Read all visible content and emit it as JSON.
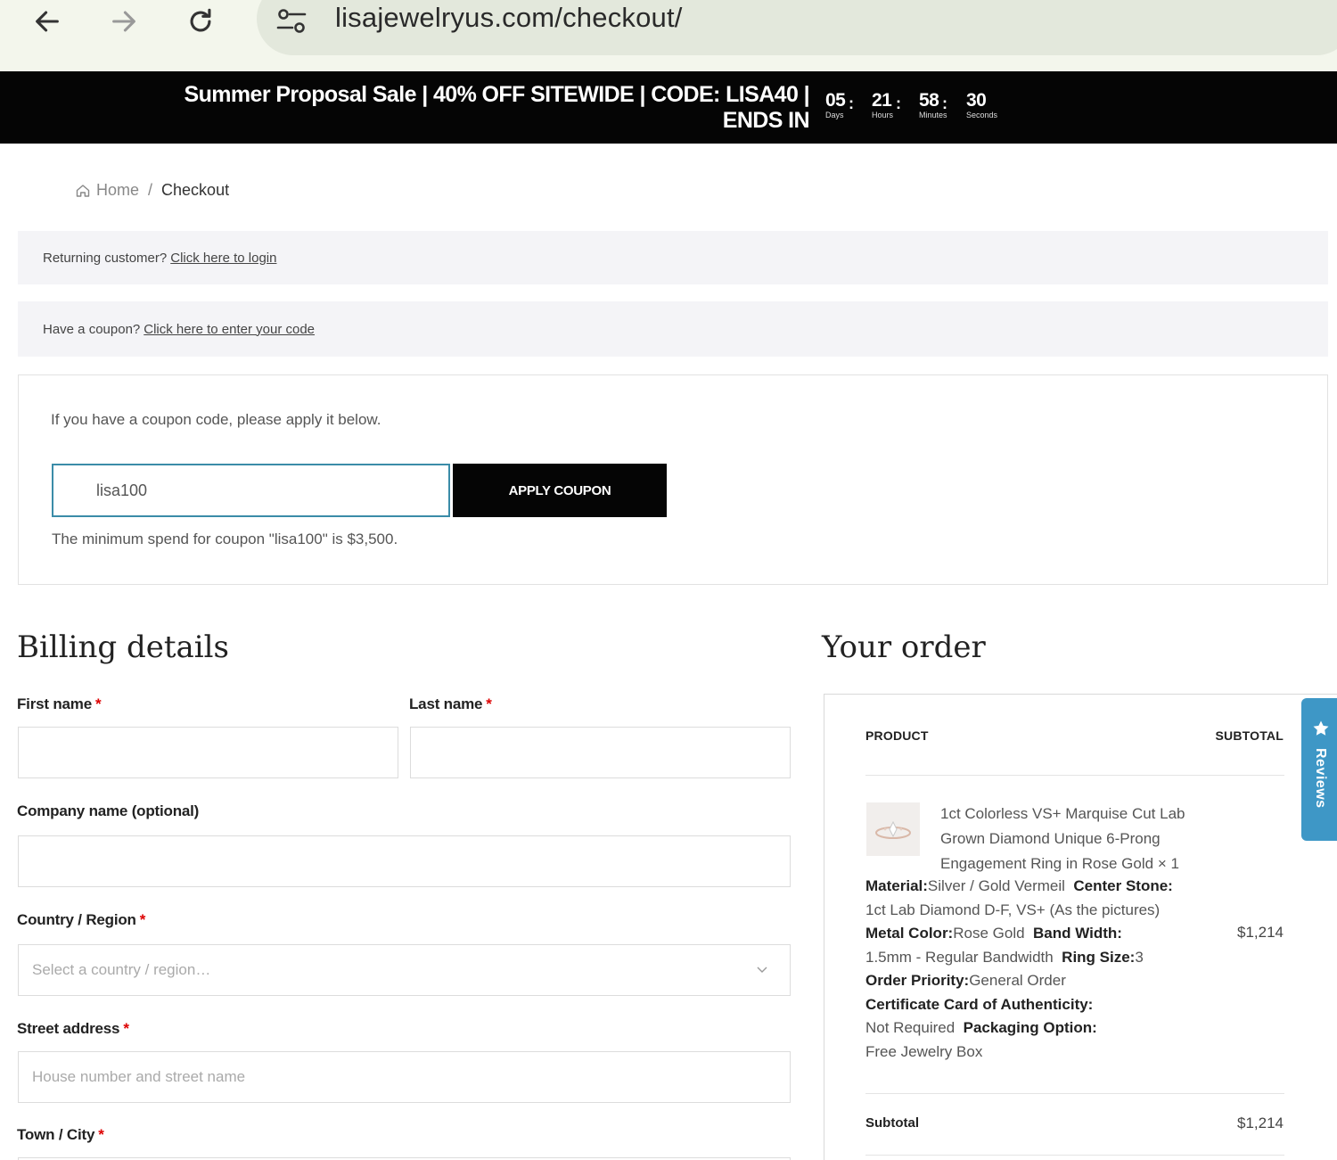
{
  "browser": {
    "url": "lisajewelryus.com/checkout/"
  },
  "promo": {
    "line1": "Summer Proposal Sale | 40% OFF SITEWIDE | CODE: LISA40 |",
    "line2": "ENDS IN",
    "countdown": [
      {
        "value": "05",
        "unit": "Days"
      },
      {
        "value": "21",
        "unit": "Hours"
      },
      {
        "value": "58",
        "unit": "Minutes"
      },
      {
        "value": "30",
        "unit": "Seconds"
      }
    ],
    "separator": ":"
  },
  "breadcrumb": {
    "home": "Home",
    "separator": "/",
    "current": "Checkout"
  },
  "notices": {
    "returning_text": "Returning customer?",
    "returning_link": "Click here to login",
    "coupon_text": "Have a coupon?",
    "coupon_link": "Click here to enter your code"
  },
  "coupon": {
    "hint": "If you have a coupon code, please apply it below.",
    "input_value": "lisa100",
    "button": "APPLY COUPON",
    "error": "The minimum spend for coupon \"lisa100\" is $3,500."
  },
  "billing": {
    "title": "Billing details",
    "required_mark": "*",
    "first_name_label": "First name",
    "last_name_label": "Last name",
    "company_label": "Company name (optional)",
    "country_label": "Country / Region",
    "country_placeholder": "Select a country / region…",
    "street_label": "Street address",
    "street_placeholder": "House number and street name",
    "city_label": "Town / City"
  },
  "order": {
    "title": "Your order",
    "col_product": "PRODUCT",
    "col_subtotal": "SUBTOTAL",
    "product_name": "1ct Colorless VS+ Marquise Cut Lab Grown Diamond Unique 6-Prong Engagement Ring in Rose Gold",
    "quantity": "× 1",
    "attributes": {
      "material_label": "Material:",
      "material_value": "Silver / Gold Vermeil",
      "center_stone_label": "Center Stone:",
      "center_stone_value": "1ct Lab Diamond D-F, VS+ (As the pictures)",
      "metal_color_label": "Metal Color:",
      "metal_color_value": "Rose Gold",
      "band_width_label": "Band Width:",
      "band_width_value": "1.5mm - Regular Bandwidth",
      "ring_size_label": "Ring Size:",
      "ring_size_value": "3",
      "order_priority_label": "Order Priority:",
      "order_priority_value": "General Order",
      "certificate_label": "Certificate Card of Authenticity:",
      "certificate_value": "Not Required",
      "packaging_label": "Packaging Option:",
      "packaging_value": "Free Jewelry Box"
    },
    "line_total": "$1,214",
    "subtotal_label": "Subtotal",
    "subtotal_value": "$1,214"
  },
  "reviews_tab": {
    "label": "Reviews",
    "color": "#3e97c6"
  },
  "colors": {
    "promo_bg": "#050505",
    "accent_input_border": "#3b8ca8",
    "required": "#dd0000"
  }
}
